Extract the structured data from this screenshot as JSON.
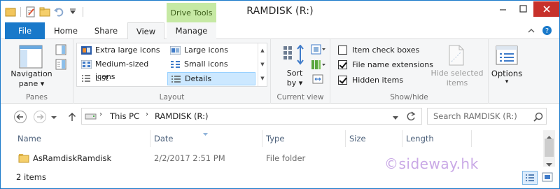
{
  "window": {
    "title": "RAMDISK (R:)",
    "context_tab": "Drive Tools"
  },
  "tabs": [
    {
      "label": "File"
    },
    {
      "label": "Home"
    },
    {
      "label": "Share"
    },
    {
      "label": "View"
    },
    {
      "label": "Manage"
    }
  ],
  "ribbon": {
    "panes": {
      "nav_pane_label": "Navigation",
      "nav_pane_label2": "pane ▾",
      "group_label": "Panes"
    },
    "layout": {
      "items": [
        {
          "label": "Extra large icons"
        },
        {
          "label": "Large icons"
        },
        {
          "label": "Medium-sized icons"
        },
        {
          "label": "Small icons"
        },
        {
          "label": "List"
        },
        {
          "label": "Details"
        }
      ],
      "selected": "Details",
      "group_label": "Layout"
    },
    "current_view": {
      "sort_label": "Sort",
      "sort_label2": "by ▾",
      "group_label": "Current view"
    },
    "show_hide": {
      "item_check_boxes": "Item check boxes",
      "file_name_extensions": "File name extensions",
      "hidden_items": "Hidden items",
      "checks": {
        "item_check_boxes": false,
        "file_name_extensions": true,
        "hidden_items": true
      },
      "hide_selected_1": "Hide selected",
      "hide_selected_2": "items",
      "group_label": "Show/hide"
    },
    "options": {
      "label": "Options",
      "arrow": "▾"
    }
  },
  "address": {
    "crumbs": [
      "This PC",
      "RAMDISK (R:)"
    ],
    "search_placeholder": "Search RAMDISK (R:)"
  },
  "columns": [
    {
      "label": "Name"
    },
    {
      "label": "Date"
    },
    {
      "label": "Type"
    },
    {
      "label": "Size"
    },
    {
      "label": "Length"
    }
  ],
  "files": [
    {
      "name": "AsRamdiskRamdisk",
      "date": "2/2/2017 2:51 PM",
      "type": "File folder",
      "size": "",
      "length": ""
    }
  ],
  "status": {
    "count": "2 items"
  },
  "watermark": "©sideway.hk",
  "colors": {
    "accent": "#1979ca",
    "context_tab": "#c6e9a4",
    "selection": "#cce8ff",
    "close_button": "#c7312b"
  }
}
